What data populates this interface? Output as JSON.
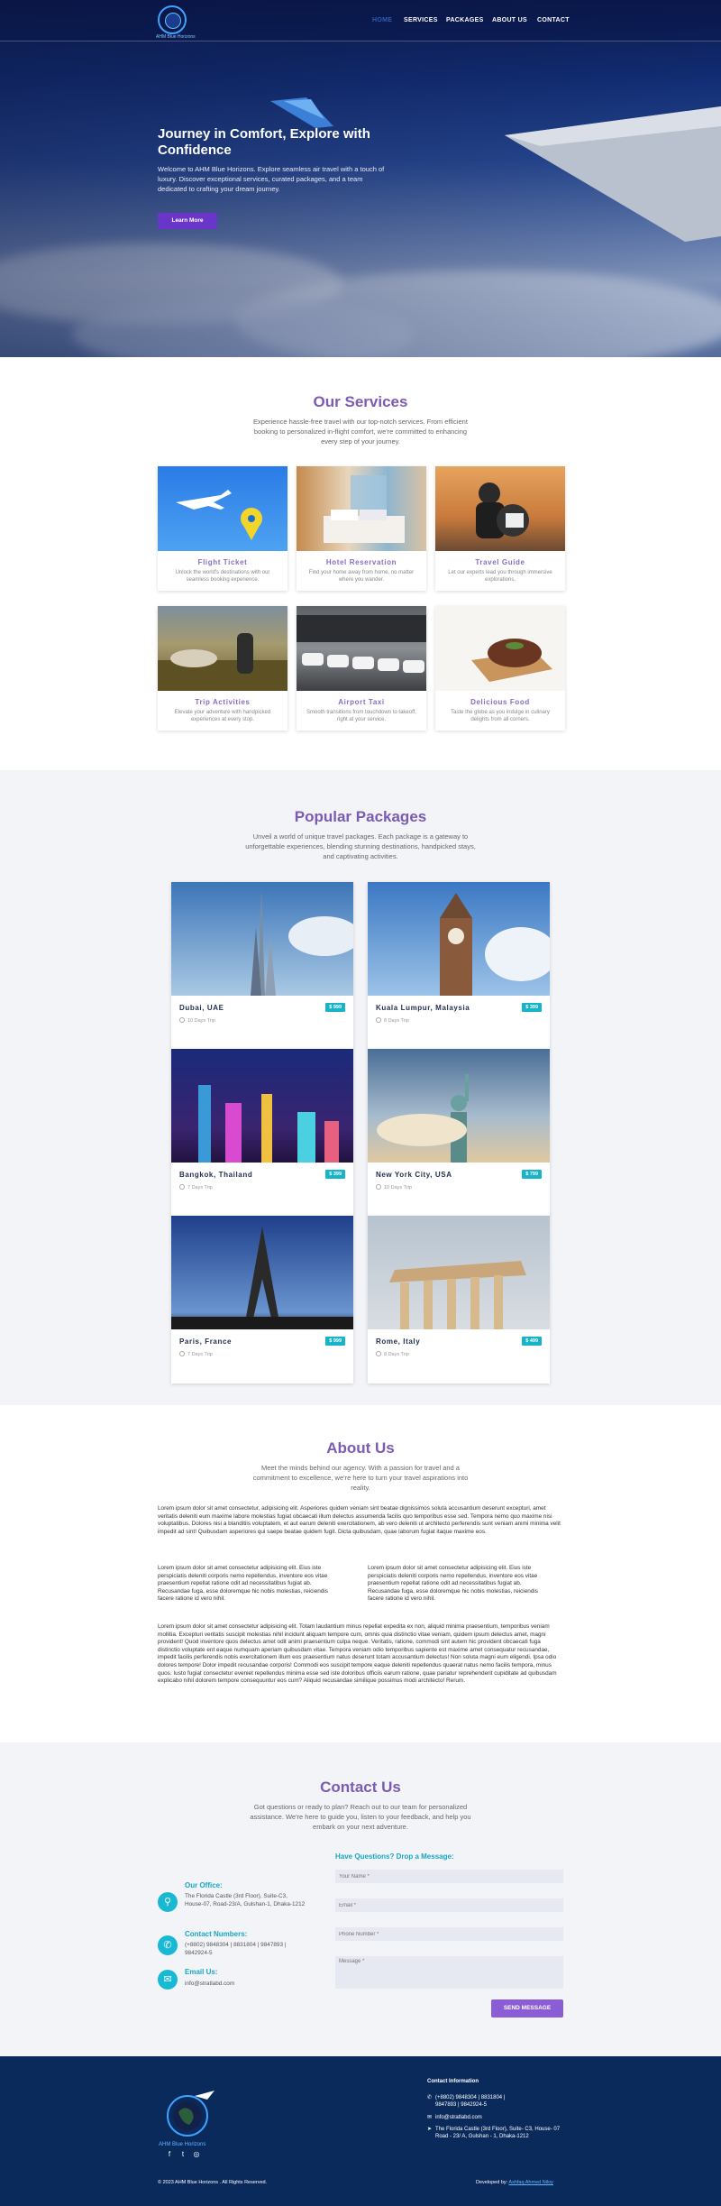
{
  "brand": {
    "logo_text": "AHM Blue Horizons"
  },
  "nav": {
    "items": [
      "HOME",
      "SERVICES",
      "PACKAGES",
      "ABOUT US",
      "CONTACT"
    ]
  },
  "hero": {
    "title": "Journey in Comfort, Explore with Confidence",
    "text": "Welcome to AHM Blue Horizons. Explore seamless air travel with a touch of luxury. Discover exceptional services, curated packages, and a team dedicated to crafting your dream journey.",
    "button": "Learn More"
  },
  "services": {
    "title": "Our Services",
    "subtitle": "Experience hassle-free travel with our top-notch services. From efficient booking to personalized in-flight comfort, we're committed to enhancing every step of your journey.",
    "items": [
      {
        "title": "Flight Ticket",
        "desc": "Unlock the world's destinations with our seamless booking experience."
      },
      {
        "title": "Hotel Reservation",
        "desc": "Find your home away from home, no matter where you wander."
      },
      {
        "title": "Travel Guide",
        "desc": "Let our experts lead you through immersive explorations."
      },
      {
        "title": "Trip Activities",
        "desc": "Elevate your adventure with handpicked experiences at every stop."
      },
      {
        "title": "Airport Taxi",
        "desc": "Smooth transitions from touchdown to takeoff, right at your service."
      },
      {
        "title": "Delicious Food",
        "desc": "Taste the globe as you indulge in culinary delights from all corners."
      }
    ]
  },
  "packages": {
    "title": "Popular Packages",
    "subtitle": "Unveil a world of unique travel packages. Each package is a gateway to unforgettable experiences, blending stunning destinations, handpicked stays, and captivating activities.",
    "items": [
      {
        "name": "Dubai, UAE",
        "price": "$ 999",
        "days": "10 Days Trip"
      },
      {
        "name": "Kuala Lumpur, Malaysia",
        "price": "$ 399",
        "days": "8 Days Trip"
      },
      {
        "name": "Bangkok, Thailand",
        "price": "$ 399",
        "days": "7 Days Trip"
      },
      {
        "name": "New York City, USA",
        "price": "$ 799",
        "days": "10 Days Trip"
      },
      {
        "name": "Paris, France",
        "price": "$ 999",
        "days": "7 Days Trip"
      },
      {
        "name": "Rome, Italy",
        "price": "$ 499",
        "days": "8 Days Trip"
      }
    ]
  },
  "about": {
    "title": "About Us",
    "subtitle": "Meet the minds behind our agency. With a passion for travel and a commitment to excellence, we're here to turn your travel aspirations into reality.",
    "p1": "Lorem ipsum dolor sit amet consectetur, adipisicing elit. Asperiores quidem veniam sint beatae dignissimos soluta accusantium deserunt excepturi, amet veritatis deleniti eum maxime labore molestias fugiat obcaecati illum delectus assumenda facilis quo temporibus esse sed. Tempora nemo quo maxime nisi voluptatibus. Dolores nisi a blanditiis voluptatem, et aut earum deleniti exercitationem, ab vero deleniti ut architecto perferendis sunt veniam animi minima velit impedit ad sint! Quibusdam asperiores qui saepe beatae quidem fugit. Dicta quibusdam, quae laborum fugiat itaque maxime eos.",
    "p2": "Lorem ipsum dolor sit amet consectetur adipisicing elit. Eius iste perspiciatis deleniti corporis nemo repellendus, inventore eos vitae praesentium repellat ratione odit ad necessitatibus fugiat ab. Recusandae fuga, esse doloremque hic nobis molestias, reiciendis facere ratione id vero nihil.",
    "p3": "Lorem ipsum dolor sit amet consectetur adipisicing elit. Eius iste perspiciatis deleniti corporis nemo repellendus, inventore eos vitae praesentium repellat ratione odit ad necessitatibus fugiat ab. Recusandae fuga, esse doloremque hic nobis molestias, reiciendis facere ratione id vero nihil.",
    "p4": "Lorem ipsum dolor sit amet consectetur adipisicing elit. Totam laudantium minus repellat expedita ex non, aliquid minima praesentium, temporibus veniam mollitia. Excepturi veritatis suscipit molestias nihil incidunt aliquam tempore cum, omnis quia distinctio vitae veniam, quidem ipsum delectus amet, magni provident! Quod inventore quos delectus amet odit animi praesentium culpa neque. Veritatis, ratione, commodi sint autem hic provident obcaecati fuga distinctio voluptate ent eaque numquam aperiam quibusdam vitae. Tempora veniam odio temporibus sapiente est maxime amet consequatur recusandae, impedit facilis perferendis nobis exercitationem illum eos praesentium natus deserunt totam accusantium delectus! Non soluta magni eum eligendi. Ipsa odio dolores tempore! Dolor impedit recusandae corporis! Commodi eos suscipit tempore eaque deleniti repellendus quaerat natus nemo facilis tempora, minus quos. Iusto fugiat consectetur eveniet repellendus minima esse sed iste doloribus officiis earum ratione, quae pariatur reprehenderit cupiditate ad quibusdam explicabo nihil dolorem tempore consequuntur eos cum? Aliquid recusandae similique possimus modi architecto! Rerum."
  },
  "contact": {
    "title": "Contact Us",
    "subtitle": "Got questions or ready to plan? Reach out to our team for personalized assistance. We're here to guide you, listen to your feedback, and help you embark on your next adventure.",
    "office_label": "Our Office:",
    "office": "The Florida Castle (3rd Floor), Suite-C3, House-07, Road-23/A, Gulshan-1, Dhaka-1212",
    "numbers_label": "Contact Numbers:",
    "numbers": "(+8802) 9848304 | 8831804 | 9847893 | 9842924-5",
    "email_label": "Email Us:",
    "email": "info@stratlabd.com",
    "form_title": "Have Questions? Drop a Message:",
    "name_ph": "Your Name *",
    "email_ph": "Email *",
    "phone_ph": "Phone Number *",
    "msg_ph": "Message *",
    "send": "SEND MESSAGE"
  },
  "footer": {
    "logo_text": "AHM Blue Horizons",
    "info_title": "Contact Information",
    "phone": "(+8802) 9848304 | 8831804 | 9847893 | 9842924-5",
    "email": "info@stratlabd.com",
    "address": "The Florida Castle (3rd Floor), Suite- C3, House- 07 Road - 23/ A, Gulshan - 1, Dhaka-1212",
    "copyright": "© 2023 AHM Blue Horizons . All Rights Reserved.",
    "dev_prefix": "Developed by",
    "dev_name": "Ashfaq Ahmed Niloy"
  },
  "colors": {
    "accent": "#7b5bb3",
    "button": "#6a35c9",
    "teal": "#19b9d4",
    "footer": "#0a2a5c"
  }
}
